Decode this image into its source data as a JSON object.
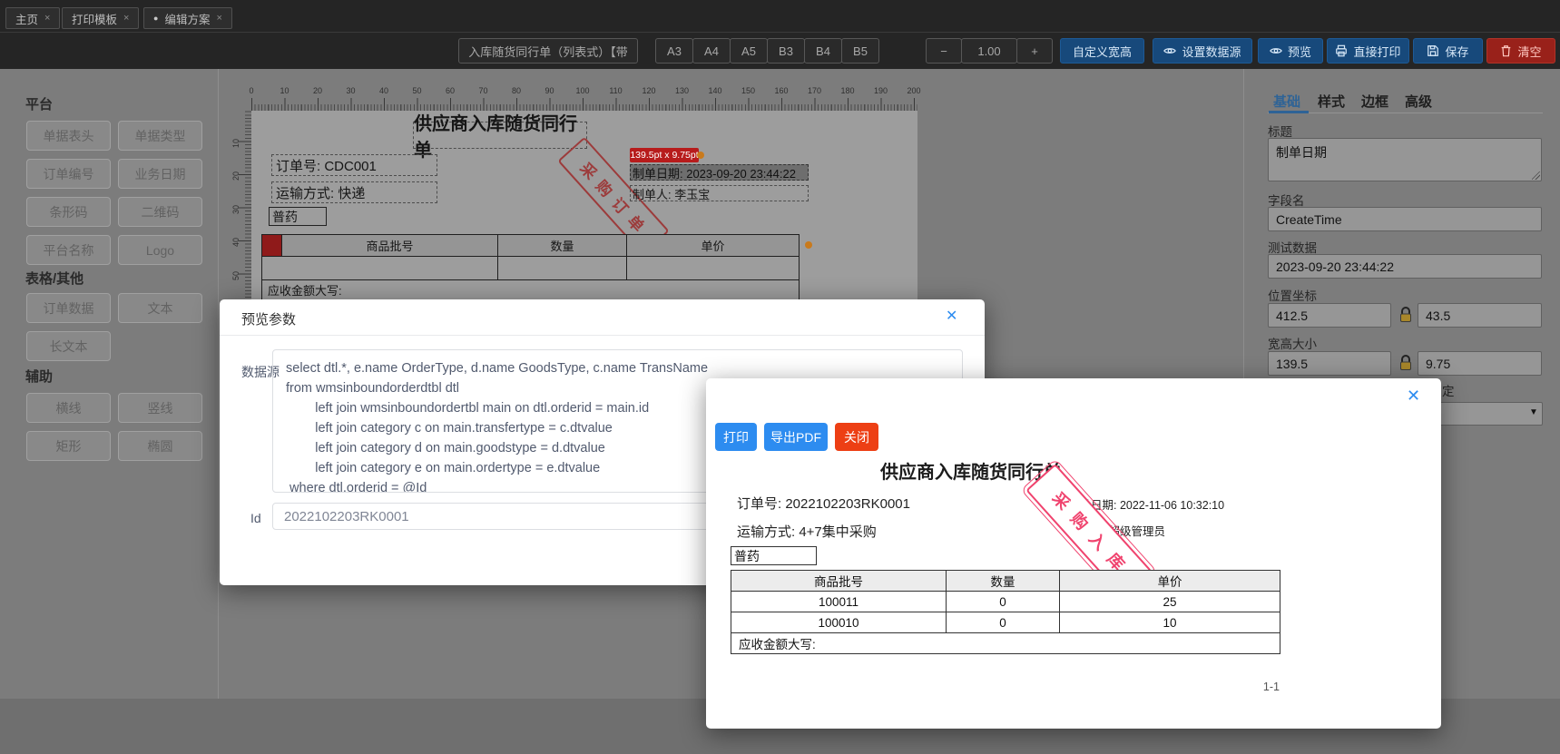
{
  "tabs": {
    "close_glyph": "×",
    "active_dot": "●",
    "items": [
      {
        "label": "主页"
      },
      {
        "label": "打印模板"
      },
      {
        "label": "编辑方案"
      }
    ]
  },
  "toolbar": {
    "template_name": "入库随货同行单（列表式）【带",
    "paper_sizes": [
      "A3",
      "A4",
      "A5",
      "B3",
      "B4",
      "B5"
    ],
    "zoom_minus": "−",
    "zoom_value": "1.00",
    "zoom_plus": "+",
    "custom_size_label": "自定义宽高",
    "set_datasource_label": "设置数据源",
    "preview_label": "预览",
    "direct_print_label": "直接打印",
    "save_label": "保存",
    "clear_label": "清空"
  },
  "sidebar": {
    "platform_title": "平台",
    "platform": [
      "单据表头",
      "单据类型",
      "订单编号",
      "业务日期",
      "条形码",
      "二维码",
      "平台名称",
      "Logo"
    ],
    "table_title": "表格/其他",
    "table_other": [
      "订单数据",
      "文本",
      "长文本"
    ],
    "aux_title": "辅助",
    "aux": [
      "横线",
      "竖线",
      "矩形",
      "椭圆"
    ]
  },
  "canvas": {
    "h_ruler_ticks": [
      "0",
      "10",
      "20",
      "30",
      "40",
      "50",
      "60",
      "70",
      "80",
      "90",
      "100",
      "110",
      "120",
      "130",
      "140",
      "150",
      "160",
      "170",
      "180",
      "190",
      "200"
    ],
    "v_ruler_ticks": [
      "10",
      "20",
      "30",
      "40",
      "50"
    ],
    "doc": {
      "title": "供应商入库随货同行单",
      "order_no": "订单号: CDC001",
      "transport": "运输方式: 快递",
      "drug_type": "普药",
      "size_tooltip": "139.5pt x 9.75pt",
      "create_date": "制单日期: 2023-09-20 23:44:22",
      "creator": "制单人: 李玉宝",
      "stamp": "采购订单",
      "table": {
        "headers": [
          "商品批号",
          "数量",
          "单价"
        ],
        "footer": "应收金额大写:"
      }
    }
  },
  "properties_panel": {
    "tabs": [
      "基础",
      "样式",
      "边框",
      "高级"
    ],
    "active_tab": "基础",
    "title_label": "标题",
    "title_value": "制单日期",
    "field_label": "字段名",
    "field_value": "CreateTime",
    "test_label": "测试数据",
    "test_value": "2023-09-20 23:44:22",
    "position_label": "位置坐标",
    "position_x": "412.5",
    "position_y": "43.5",
    "size_label": "宽高大小",
    "size_w": "139.5",
    "size_h": "9.75",
    "partial_label": "定"
  },
  "preview_params_modal": {
    "title": "预览参数",
    "close_glyph": "✕",
    "datasource_label": "数据源",
    "sql": "select dtl.*, e.name OrderType, d.name GoodsType, c.name TransName\nfrom wmsinboundorderdtbl dtl\n        left join wmsinboundordertbl main on dtl.orderid = main.id\n        left join category c on main.transfertype = c.dtvalue\n        left join category d on main.goodstype = d.dtvalue\n        left join category e on main.ordertype = e.dtvalue\n where dtl.orderid = @Id",
    "id_label": "Id",
    "id_value": "2022102203RK0001"
  },
  "preview_modal": {
    "close_glyph": "✕",
    "print_label": "打印",
    "export_pdf_label": "导出PDF",
    "close_label": "关闭",
    "doc": {
      "title": "供应商入库随货同行单",
      "order_no": "订单号: 2022102203RK0001",
      "create_date": "制单日期: 2022-11-06 10:32:10",
      "transport": "运输方式: 4+7集中采购",
      "creator": "制单人: 超级管理员",
      "drug_type": "普药",
      "stamp": "采购入库",
      "table": {
        "headers": [
          "商品批号",
          "数量",
          "单价"
        ],
        "rows": [
          [
            "100011",
            "0",
            "25"
          ],
          [
            "100010",
            "0",
            "10"
          ]
        ],
        "footer": "应收金额大写:"
      },
      "page": "1-1"
    }
  },
  "colors": {
    "primary_blue": "#2d8cf0",
    "danger_red": "#ed3f14",
    "toolbar_blue": "#17497b",
    "toolbar_red": "#99211a",
    "stamp_red": "#f0436e",
    "canvas_stamp_red": "#9c3b3b",
    "tooltip_red": "#b71c1c",
    "handle_orange": "#c97a1c"
  }
}
